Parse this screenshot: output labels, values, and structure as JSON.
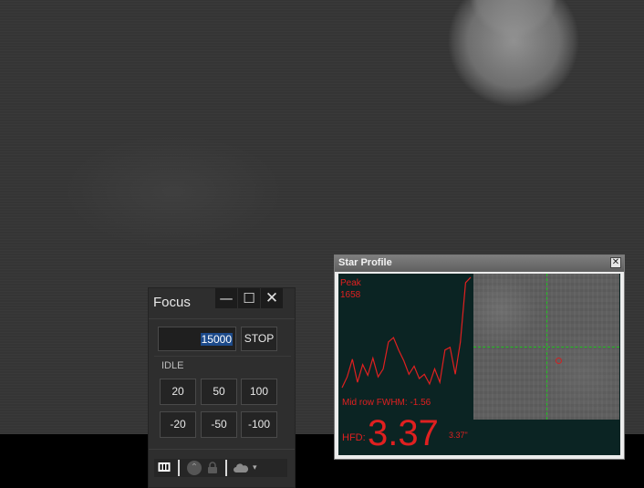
{
  "focus_window": {
    "title": "Focus",
    "minimize_glyph": "—",
    "maximize_glyph": "☐",
    "close_glyph": "✕",
    "position_value": "15000",
    "stop_label": "STOP",
    "status": "IDLE",
    "step_buttons": [
      "20",
      "50",
      "100",
      "-20",
      "-50",
      "-100"
    ],
    "toolbar": {
      "icons": [
        "counter-icon",
        "up-arrow-icon",
        "lock-icon",
        "cloud-icon",
        "dropdown-arrow-icon"
      ],
      "dropdown_glyph": "▾"
    }
  },
  "star_profile": {
    "title": "Star Profile",
    "close_glyph": "✕",
    "peak_label": "Peak",
    "peak_value": "1658",
    "fwhm_text": "Mid row FWHM: -1.56",
    "hfd_label": "HFD:",
    "hfd_value": "3.37",
    "hfd_arcsec": "3.37\"",
    "profile_samples": [
      5,
      25,
      58,
      15,
      48,
      28,
      60,
      25,
      40,
      90,
      98,
      75,
      55,
      30,
      45,
      22,
      30,
      12,
      40,
      15,
      75,
      80,
      30,
      90,
      200,
      210
    ],
    "colors": {
      "text": "#e02020",
      "crosshair": "#1ec21e",
      "background": "#0b2423"
    }
  }
}
